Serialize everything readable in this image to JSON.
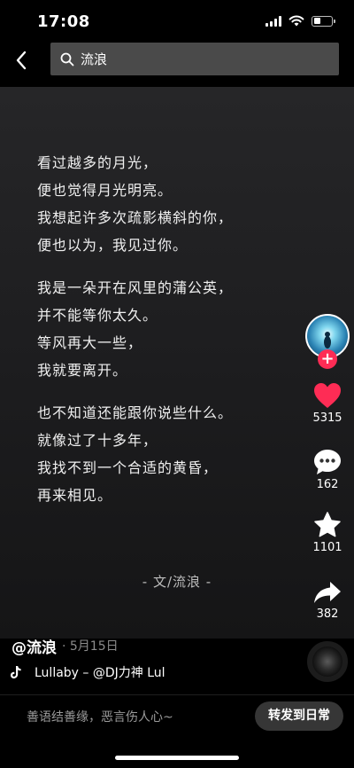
{
  "status_bar": {
    "time": "17:08"
  },
  "search": {
    "query": "流浪"
  },
  "poem": {
    "stanzas": [
      [
        "看过越多的月光，",
        "便也觉得月光明亮。",
        "我想起许多次疏影横斜的你，",
        "便也以为，我见过你。"
      ],
      [
        "我是一朵开在风里的蒲公英，",
        "并不能等你太久。",
        "等风再大一些，",
        "我就要离开。"
      ],
      [
        "也不知道还能跟你说些什么。",
        "就像过了十多年，",
        "我找不到一个合适的黄昏，",
        "再来相见。"
      ]
    ],
    "signature": "- 文/流浪 -"
  },
  "actions": {
    "follow_symbol": "+",
    "likes": "5315",
    "comments": "162",
    "favorites": "1101",
    "shares": "382"
  },
  "post": {
    "author": "@流浪",
    "date": "· 5月15日",
    "music": "Lullaby – @DJ力神    Lul"
  },
  "comment_bar": {
    "placeholder": "善语结善缘，恶言伤人心~",
    "share_button": "转发到日常"
  },
  "colors": {
    "like": "#fe2c55",
    "follow": "#fe2c55",
    "background": "#000000"
  },
  "icons": [
    "back-icon",
    "search-icon",
    "heart-icon",
    "comment-icon",
    "star-icon",
    "share-icon",
    "tiktok-note-icon"
  ]
}
